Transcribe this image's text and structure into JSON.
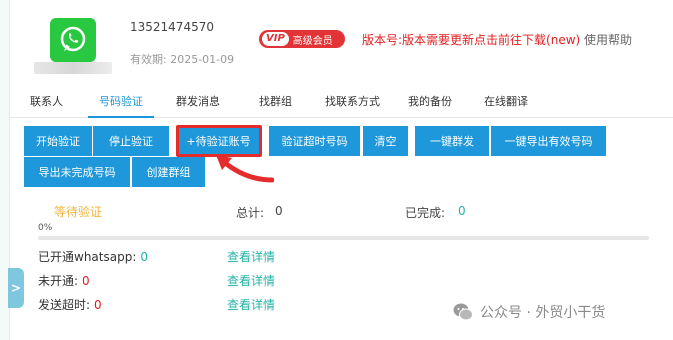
{
  "profile": {
    "phone": "13521474570",
    "expiry": "有效期: 2025-01-09",
    "vip_tag": "VIP",
    "vip_label": "高级会员",
    "version_notice": "版本号:版本需要更新点击前往下载(new)",
    "help_label": "使用帮助"
  },
  "tabs": [
    {
      "label": "联系人"
    },
    {
      "label": "号码验证",
      "active": true
    },
    {
      "label": "群发消息"
    },
    {
      "label": "找群组"
    },
    {
      "label": "找联系方式"
    },
    {
      "label": "我的备份"
    },
    {
      "label": "在线翻译"
    }
  ],
  "toolbar": [
    {
      "label": "开始验证"
    },
    {
      "label": "停止验证"
    },
    {
      "label": "+待验证账号"
    },
    {
      "label": "验证超时号码"
    },
    {
      "label": "清空"
    },
    {
      "label": "一键群发"
    },
    {
      "label": "一键导出有效号码"
    },
    {
      "label": "导出未完成号码"
    },
    {
      "label": "创建群组"
    }
  ],
  "stats": {
    "pending": "等待验证",
    "total_label": "总计:",
    "total_value": "0",
    "done_label": "已完成:",
    "done_value": "0"
  },
  "progress": {
    "label": "0%",
    "value": 0
  },
  "results": [
    {
      "label": "已开通whatsapp:",
      "value": "0",
      "color": "#26b2a6",
      "link": "查看详情"
    },
    {
      "label": "未开通:",
      "value": "0",
      "color": "#e02020",
      "link": "查看详情"
    },
    {
      "label": "发送超时:",
      "value": "0",
      "color": "#e02020",
      "link": "查看详情"
    }
  ],
  "watermark": "公众号 · 外贸小干货",
  "colors": {
    "accent": "#1e98da",
    "brand_green": "#28c840",
    "alert_red": "#e02020",
    "highlight": "#e42c2c"
  }
}
